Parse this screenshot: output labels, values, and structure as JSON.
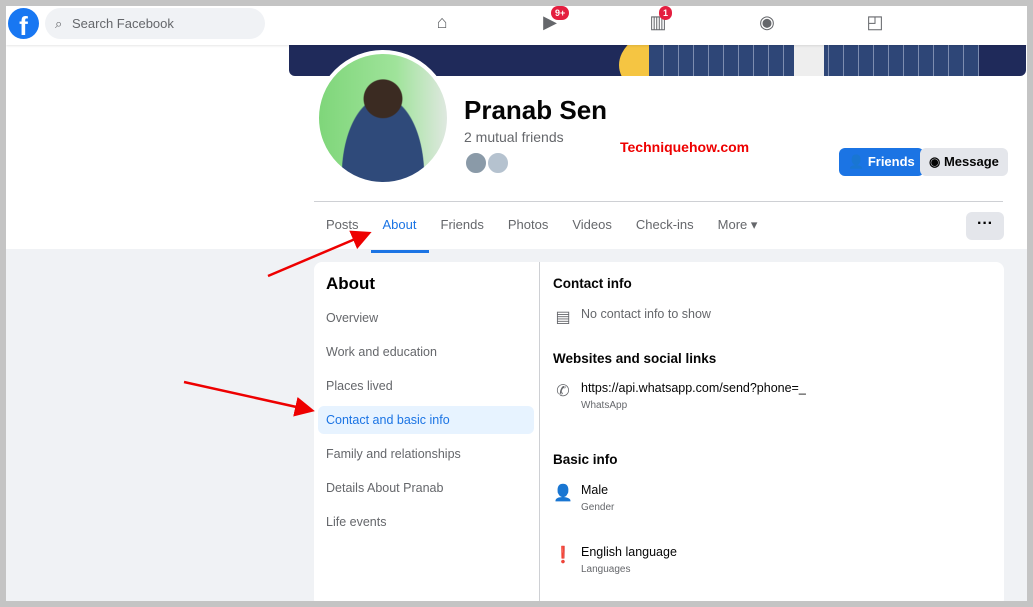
{
  "topbar": {
    "search_placeholder": "Search Facebook",
    "logo": "f",
    "watch_badge": "9+",
    "marketplace_badge": "1"
  },
  "profile": {
    "name": "Pranab Sen",
    "mutual_friends": "2 mutual friends",
    "watermark": "Techniquehow.com",
    "friends_button": "Friends",
    "message_button": "Message",
    "more_button": "···"
  },
  "tabs": [
    {
      "label": "Posts"
    },
    {
      "label": "About"
    },
    {
      "label": "Friends"
    },
    {
      "label": "Photos"
    },
    {
      "label": "Videos"
    },
    {
      "label": "Check-ins"
    },
    {
      "label": "More ▾"
    }
  ],
  "about": {
    "title": "About",
    "items": [
      {
        "label": "Overview"
      },
      {
        "label": "Work and education"
      },
      {
        "label": "Places lived"
      },
      {
        "label": "Contact and basic info"
      },
      {
        "label": "Family and relationships"
      },
      {
        "label": "Details About Pranab"
      },
      {
        "label": "Life events"
      }
    ]
  },
  "contact": {
    "title": "Contact info",
    "empty": "No contact info to show"
  },
  "websites": {
    "title": "Websites and social links",
    "url": "https://api.whatsapp.com/send?phone=_",
    "url_label": "WhatsApp"
  },
  "basic": {
    "title": "Basic info",
    "gender": "Male",
    "gender_label": "Gender",
    "language": "English language",
    "language_label": "Languages"
  },
  "colors": {
    "accent": "#1b74e4",
    "annotation": "#e00000"
  }
}
